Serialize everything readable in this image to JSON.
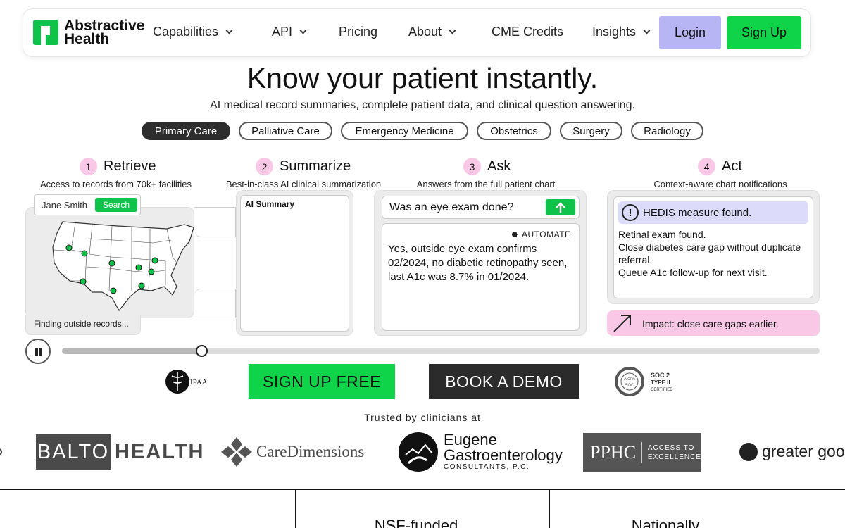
{
  "nav": {
    "logo_line1": "Abstractive",
    "logo_line2": "Health",
    "items": [
      {
        "label": "Capabilities",
        "dropdown": true
      },
      {
        "label": "API",
        "dropdown": true
      },
      {
        "label": "Pricing",
        "dropdown": false
      },
      {
        "label": "About",
        "dropdown": true
      },
      {
        "label": "CME Credits",
        "dropdown": false
      },
      {
        "label": "Insights",
        "dropdown": true
      }
    ],
    "login": "Login",
    "signup": "Sign Up"
  },
  "hero": {
    "title": "Know your patient instantly.",
    "subtitle": "AI medical record summaries, complete patient data, and clinical question answering.",
    "specialties": [
      "Primary Care",
      "Palliative Care",
      "Emergency Medicine",
      "Obstetrics",
      "Surgery",
      "Radiology"
    ],
    "active_specialty": "Primary Care"
  },
  "steps": [
    {
      "num": "1",
      "title": "Retrieve",
      "desc": "Access to records from 70k+ facilities"
    },
    {
      "num": "2",
      "title": "Summarize",
      "desc": "Best-in-class AI clinical summarization"
    },
    {
      "num": "3",
      "title": "Ask",
      "desc": "Answers from the full patient chart"
    },
    {
      "num": "4",
      "title": "Act",
      "desc": "Context-aware chart notifications"
    }
  ],
  "retrieve": {
    "patient_name": "Jane Smith",
    "search_button": "Search",
    "status": "Finding outside records..."
  },
  "summarize": {
    "label": "AI Summary"
  },
  "ask": {
    "question": "Was an eye exam done?",
    "automate_label": "AUTOMATE",
    "answer": "Yes, outside eye exam confirms 02/2024, no diabetic retinopathy seen, last A1c was 8.7% in 01/2024."
  },
  "act": {
    "alert": "HEDIS measure found.",
    "lines": [
      "Retinal exam found.",
      "Close diabetes care gap without duplicate referral.",
      "Queue A1c follow-up for next visit."
    ],
    "impact": "Impact: close care gaps earlier."
  },
  "progress": {
    "fraction": 0.184
  },
  "cta": {
    "signup": "SIGN UP FREE",
    "demo": "BOOK A DEMO"
  },
  "badges": {
    "hipaa": "HIPAA",
    "soc_line1": "SOC 2",
    "soc_line2": "TYPE II",
    "soc_line3": "CERTIFIED",
    "aicpa": "AICPA",
    "soc_small": "SOC"
  },
  "trusted": {
    "label": "Trusted by clinicians at",
    "balto_box": "BALTO",
    "balto_rest": "HEALTH",
    "care": "CareDimensions",
    "eugene_1": "Eugene",
    "eugene_2": "Gastroenterology",
    "eugene_3": "CONSULTANTS, P.C.",
    "pphc": "PPHC",
    "pphc_sub1": "ACCESS TO",
    "pphc_sub2": "EXCELLENCE",
    "greater": "greater good"
  },
  "bottom": {
    "col2": "NSF-funded",
    "col3": "Nationally"
  },
  "colors": {
    "brand_green": "#0fc34a",
    "login_purple": "#b7b5f3",
    "step_pink": "#f8c8e6",
    "alert_lavender": "#dcdcfa"
  }
}
